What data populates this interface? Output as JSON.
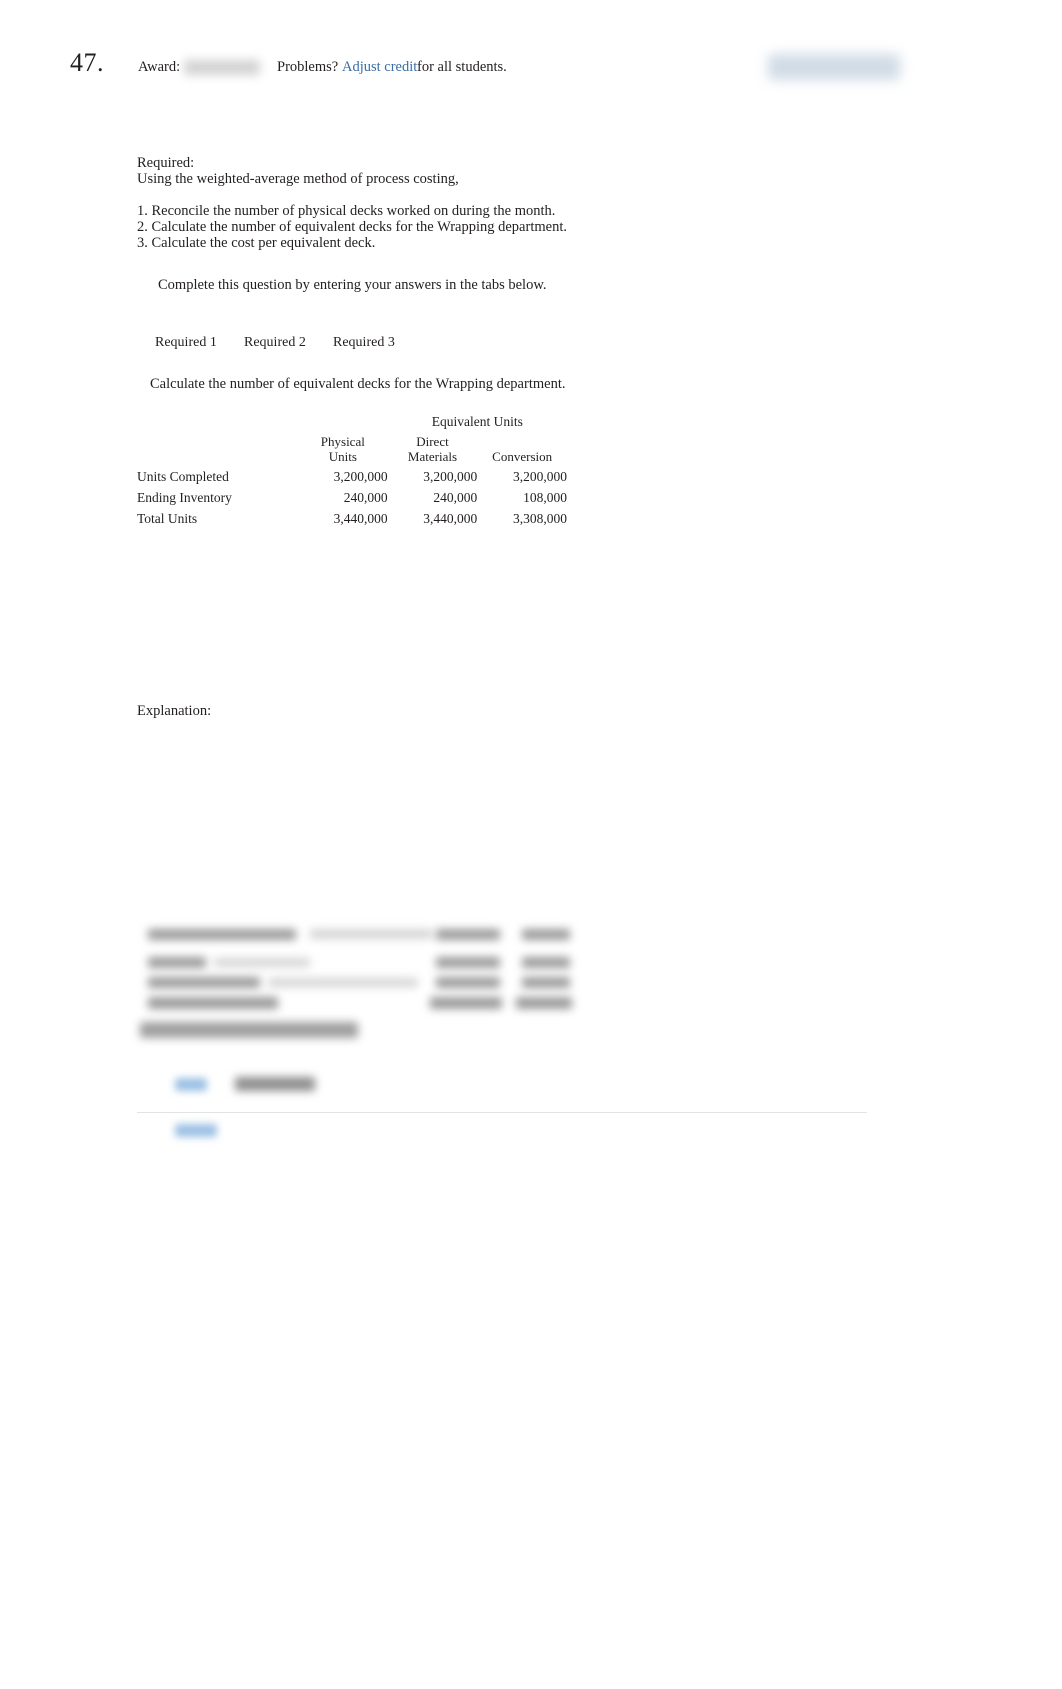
{
  "header": {
    "question_number": "47.",
    "award_label": "Award:",
    "award_value": "",
    "problems_label": "Problems?",
    "adjust_credit_link": "Adjust credit",
    "for_all_students": "for all students.",
    "top_right_button": ""
  },
  "required": {
    "title": "Required:",
    "subtitle": "Using the weighted-average method of process costing,",
    "items": [
      "1. Reconcile the number of physical decks worked on during the month.",
      "2. Calculate the number of equivalent decks for the Wrapping department.",
      "3. Calculate the cost per equivalent deck."
    ]
  },
  "instruction": "Complete this question by entering your answers in the tabs below.",
  "tabs": [
    {
      "label": "Required 1",
      "active": false
    },
    {
      "label": "Required 2",
      "active": true
    },
    {
      "label": "Required 3",
      "active": false
    }
  ],
  "sub_instruction": "Calculate the number of equivalent decks for the Wrapping department.",
  "table": {
    "group_header": "Equivalent Units",
    "columns": [
      "",
      "Physical\nUnits",
      "Direct\nMaterials",
      "Conversion"
    ],
    "column_physical_line1": "Physical",
    "column_physical_line2": "Units",
    "column_direct_line1": "Direct",
    "column_direct_line2": "Materials",
    "column_conversion": "Conversion",
    "rows": [
      {
        "label": "Units Completed",
        "physical_units": "3,200,000",
        "direct_materials": "3,200,000",
        "conversion": "3,200,000"
      },
      {
        "label": "Ending Inventory",
        "physical_units": "240,000",
        "direct_materials": "240,000",
        "conversion": "108,000"
      },
      {
        "label": "Total Units",
        "physical_units": "3,440,000",
        "direct_materials": "3,440,000",
        "conversion": "3,308,000"
      }
    ]
  },
  "explanation": {
    "label": "Explanation:",
    "content_redacted": ""
  },
  "colors": {
    "link": "#3a6ea5",
    "text": "#231f20",
    "background": "#ffffff",
    "divider": "#e3e3e3"
  }
}
